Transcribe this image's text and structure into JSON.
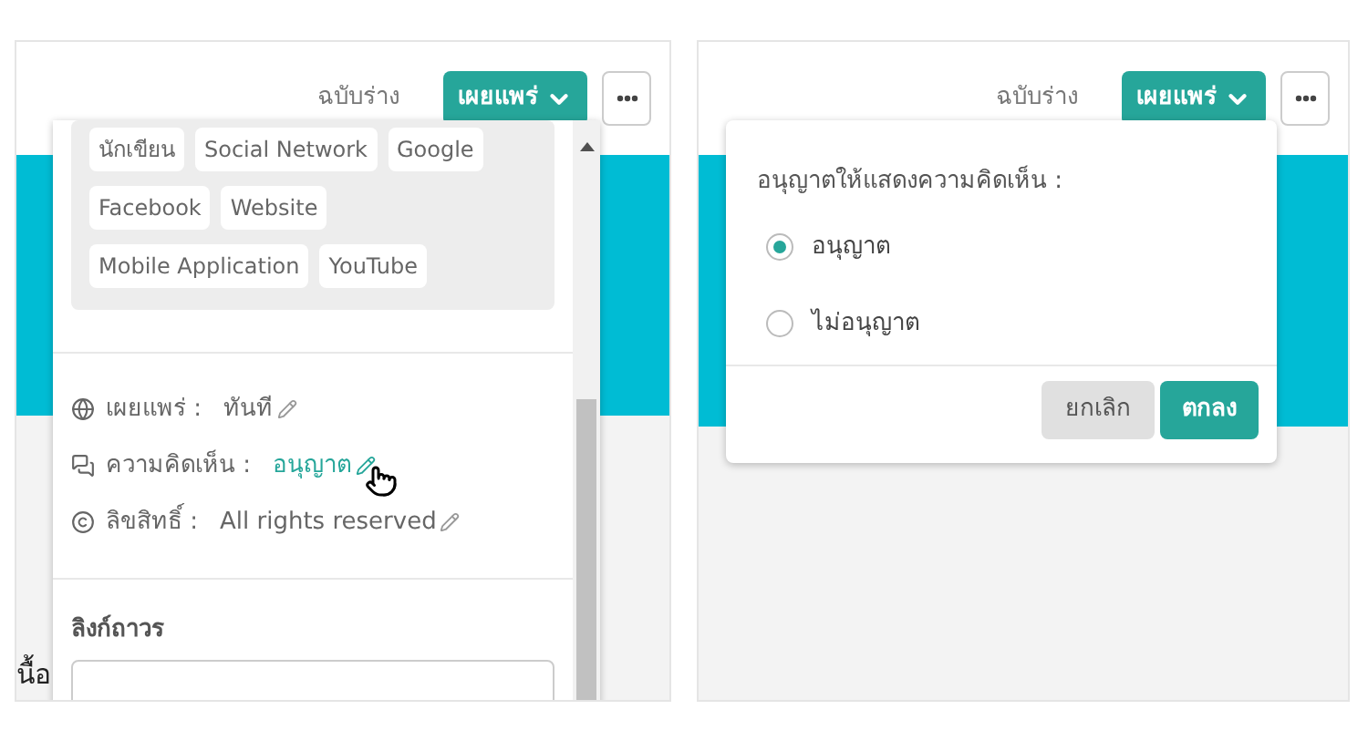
{
  "left_panel": {
    "draft_link": "ฉบับร่าง",
    "publish_button": "เผยแพร่",
    "tags": [
      "นักเขียน",
      "Social Network",
      "Google",
      "Facebook",
      "Website",
      "Mobile Application",
      "YouTube"
    ],
    "settings": [
      {
        "kind": "publish",
        "label": "เผยแพร่ :",
        "value": "ทันที",
        "highlighted": false
      },
      {
        "kind": "comments",
        "label": "ความคิดเห็น :",
        "value": "อนุญาต",
        "highlighted": true
      },
      {
        "kind": "copyright",
        "label": "ลิขสิทธิ์ :",
        "value": "All rights reserved",
        "highlighted": false
      }
    ],
    "permalink_label": "ลิงก์ถาวร",
    "background_text": "นื้อ"
  },
  "right_panel": {
    "draft_link": "ฉบับร่าง",
    "publish_button": "เผยแพร่",
    "popover_title": "อนุญาตให้แสดงความคิดเห็น :",
    "options": [
      {
        "label": "อนุญาต",
        "selected": true
      },
      {
        "label": "ไม่อนุญาต",
        "selected": false
      }
    ],
    "cancel_button": "ยกเลิก",
    "ok_button": "ตกลง"
  }
}
